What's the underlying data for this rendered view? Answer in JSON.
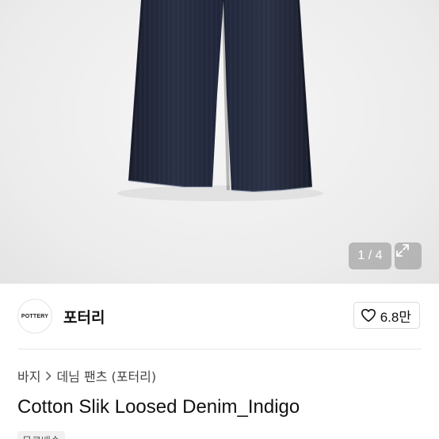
{
  "gallery": {
    "counter": "1 / 4",
    "expand_icon": "expand-icon"
  },
  "store": {
    "logo_text": "POTTERY",
    "name": "포터리",
    "like_icon": "heart-icon",
    "like_count": "6.8만"
  },
  "breadcrumb": {
    "items": [
      "바지",
      "데님 팬츠 (포터리)"
    ],
    "separator_icon": "chevron-right-icon"
  },
  "product": {
    "title": "Cotton Slik Loosed Denim_Indigo",
    "tag": "무료배송"
  },
  "colors": {
    "denim": "#23283a",
    "overlay": "#8c8c8c"
  }
}
